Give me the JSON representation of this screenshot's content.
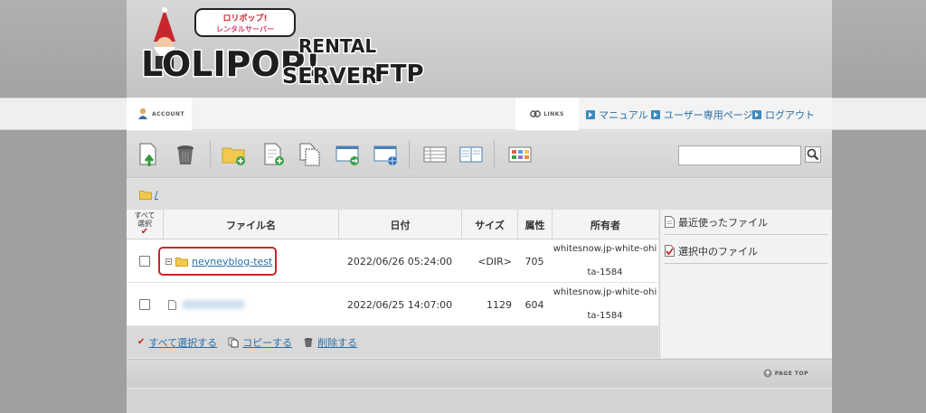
{
  "brand": {
    "badge": "ロリポップ! レンタルサーバー",
    "line1": "LOLIPOP!",
    "line2a": "RENTAL",
    "line2b": "SERVER",
    "line3": "FTP"
  },
  "nav": {
    "account_label": "ACCOUNT",
    "links_label": "LINKS",
    "links": [
      {
        "label": "マニュアル"
      },
      {
        "label": "ユーザー専用ページ"
      },
      {
        "label": "ログアウト"
      }
    ]
  },
  "toolbar": {
    "icons": [
      "upload-file-icon",
      "trash-icon",
      "new-folder-icon",
      "new-file-icon",
      "copy-icon",
      "move-icon",
      "web-icon",
      "list-view-icon",
      "split-view-icon",
      "thumbnail-view-icon"
    ],
    "search_value": ""
  },
  "breadcrumb": {
    "path": "/"
  },
  "table": {
    "select_all_header": "すべて 選択",
    "columns": [
      "ファイル名",
      "日付",
      "サイズ",
      "属性",
      "所有者"
    ],
    "rows": [
      {
        "type": "folder",
        "name": "neyneyblog-test",
        "date": "2022/06/26 05:24:00",
        "size": "<DIR>",
        "perm": "705",
        "owner_l1": "whitesnow.jp-white-ohi",
        "owner_l2": "ta-1584"
      },
      {
        "type": "file",
        "name": "",
        "date": "2022/06/25 14:07:00",
        "size": "1129",
        "perm": "604",
        "owner_l1": "whitesnow.jp-white-ohi",
        "owner_l2": "ta-1584"
      }
    ]
  },
  "actions": {
    "select_all": "すべて選択する",
    "copy": "コピーする",
    "delete": "削除する"
  },
  "side": {
    "recent": "最近使ったファイル",
    "selected": "選択中のファイル"
  },
  "footer": {
    "pagetop": "PAGE TOP"
  },
  "colors": {
    "link": "#2a6fa8",
    "highlight": "#c8262c"
  }
}
